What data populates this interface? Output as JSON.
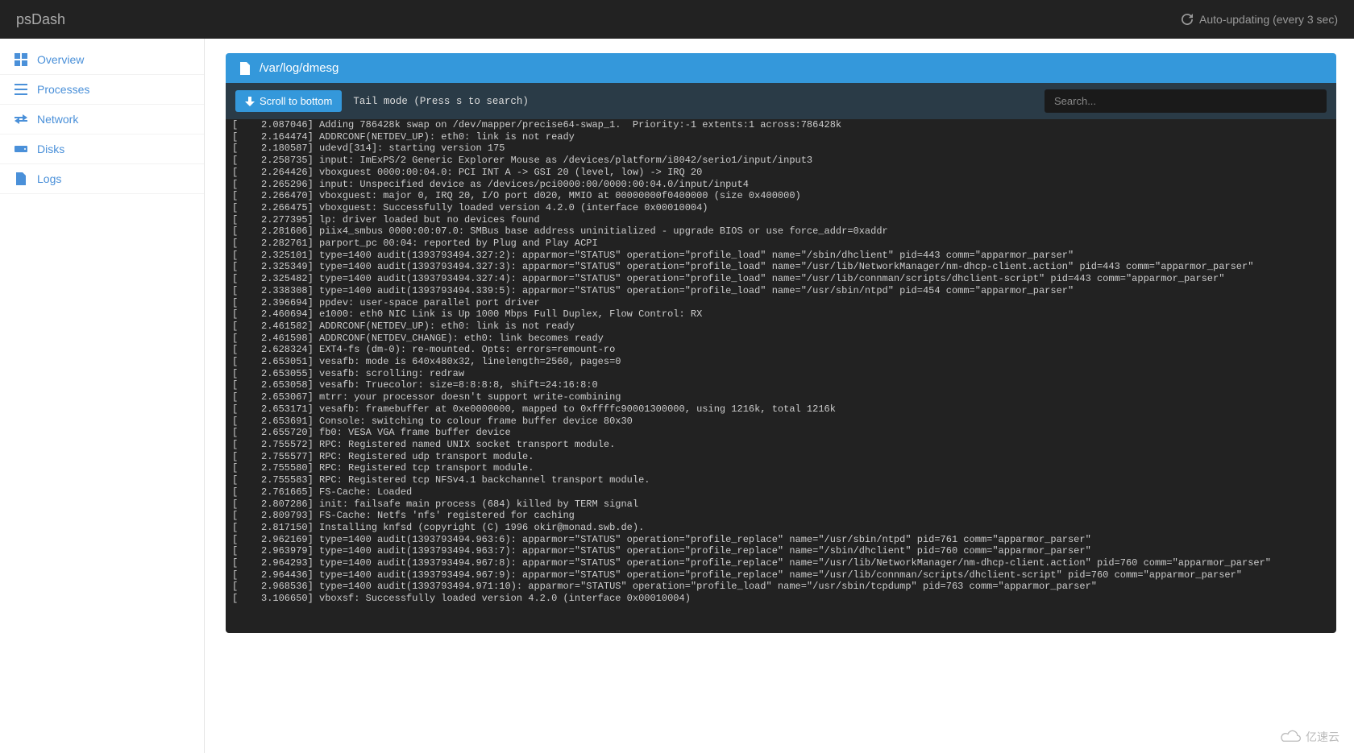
{
  "header": {
    "brand": "psDash",
    "auto_update": "Auto-updating (every 3 sec)"
  },
  "sidebar": {
    "items": [
      {
        "label": "Overview",
        "icon": "grid-icon"
      },
      {
        "label": "Processes",
        "icon": "list-icon"
      },
      {
        "label": "Network",
        "icon": "transfer-icon"
      },
      {
        "label": "Disks",
        "icon": "hdd-icon"
      },
      {
        "label": "Logs",
        "icon": "file-icon"
      }
    ]
  },
  "panel": {
    "title": "/var/log/dmesg",
    "scroll_btn": "Scroll to bottom",
    "tail_mode": "Tail mode (Press s to search)",
    "search_placeholder": "Search..."
  },
  "log_lines": [
    "[    2.087046] Adding 786428k swap on /dev/mapper/precise64-swap_1.  Priority:-1 extents:1 across:786428k",
    "[    2.164474] ADDRCONF(NETDEV_UP): eth0: link is not ready",
    "[    2.180587] udevd[314]: starting version 175",
    "[    2.258735] input: ImExPS/2 Generic Explorer Mouse as /devices/platform/i8042/serio1/input/input3",
    "[    2.264426] vboxguest 0000:00:04.0: PCI INT A -> GSI 20 (level, low) -> IRQ 20",
    "[    2.265296] input: Unspecified device as /devices/pci0000:00/0000:00:04.0/input/input4",
    "[    2.266470] vboxguest: major 0, IRQ 20, I/O port d020, MMIO at 00000000f0400000 (size 0x400000)",
    "[    2.266475] vboxguest: Successfully loaded version 4.2.0 (interface 0x00010004)",
    "[    2.277395] lp: driver loaded but no devices found",
    "[    2.281606] piix4_smbus 0000:00:07.0: SMBus base address uninitialized - upgrade BIOS or use force_addr=0xaddr",
    "[    2.282761] parport_pc 00:04: reported by Plug and Play ACPI",
    "[    2.325101] type=1400 audit(1393793494.327:2): apparmor=\"STATUS\" operation=\"profile_load\" name=\"/sbin/dhclient\" pid=443 comm=\"apparmor_parser\"",
    "[    2.325349] type=1400 audit(1393793494.327:3): apparmor=\"STATUS\" operation=\"profile_load\" name=\"/usr/lib/NetworkManager/nm-dhcp-client.action\" pid=443 comm=\"apparmor_parser\"",
    "[    2.325482] type=1400 audit(1393793494.327:4): apparmor=\"STATUS\" operation=\"profile_load\" name=\"/usr/lib/connman/scripts/dhclient-script\" pid=443 comm=\"apparmor_parser\"",
    "[    2.338308] type=1400 audit(1393793494.339:5): apparmor=\"STATUS\" operation=\"profile_load\" name=\"/usr/sbin/ntpd\" pid=454 comm=\"apparmor_parser\"",
    "[    2.396694] ppdev: user-space parallel port driver",
    "[    2.460694] e1000: eth0 NIC Link is Up 1000 Mbps Full Duplex, Flow Control: RX",
    "[    2.461582] ADDRCONF(NETDEV_UP): eth0: link is not ready",
    "[    2.461598] ADDRCONF(NETDEV_CHANGE): eth0: link becomes ready",
    "[    2.628324] EXT4-fs (dm-0): re-mounted. Opts: errors=remount-ro",
    "[    2.653051] vesafb: mode is 640x480x32, linelength=2560, pages=0",
    "[    2.653055] vesafb: scrolling: redraw",
    "[    2.653058] vesafb: Truecolor: size=8:8:8:8, shift=24:16:8:0",
    "[    2.653067] mtrr: your processor doesn't support write-combining",
    "[    2.653171] vesafb: framebuffer at 0xe0000000, mapped to 0xffffc90001300000, using 1216k, total 1216k",
    "[    2.653691] Console: switching to colour frame buffer device 80x30",
    "[    2.655720] fb0: VESA VGA frame buffer device",
    "[    2.755572] RPC: Registered named UNIX socket transport module.",
    "[    2.755577] RPC: Registered udp transport module.",
    "[    2.755580] RPC: Registered tcp transport module.",
    "[    2.755583] RPC: Registered tcp NFSv4.1 backchannel transport module.",
    "[    2.761665] FS-Cache: Loaded",
    "[    2.807286] init: failsafe main process (684) killed by TERM signal",
    "[    2.809793] FS-Cache: Netfs 'nfs' registered for caching",
    "[    2.817150] Installing knfsd (copyright (C) 1996 okir@monad.swb.de).",
    "[    2.962169] type=1400 audit(1393793494.963:6): apparmor=\"STATUS\" operation=\"profile_replace\" name=\"/usr/sbin/ntpd\" pid=761 comm=\"apparmor_parser\"",
    "[    2.963979] type=1400 audit(1393793494.963:7): apparmor=\"STATUS\" operation=\"profile_replace\" name=\"/sbin/dhclient\" pid=760 comm=\"apparmor_parser\"",
    "[    2.964293] type=1400 audit(1393793494.967:8): apparmor=\"STATUS\" operation=\"profile_replace\" name=\"/usr/lib/NetworkManager/nm-dhcp-client.action\" pid=760 comm=\"apparmor_parser\"",
    "[    2.964436] type=1400 audit(1393793494.967:9): apparmor=\"STATUS\" operation=\"profile_replace\" name=\"/usr/lib/connman/scripts/dhclient-script\" pid=760 comm=\"apparmor_parser\"",
    "[    2.968536] type=1400 audit(1393793494.971:10): apparmor=\"STATUS\" operation=\"profile_load\" name=\"/usr/sbin/tcpdump\" pid=763 comm=\"apparmor_parser\"",
    "[    3.106650] vboxsf: Successfully loaded version 4.2.0 (interface 0x00010004)"
  ],
  "watermark": "亿速云"
}
